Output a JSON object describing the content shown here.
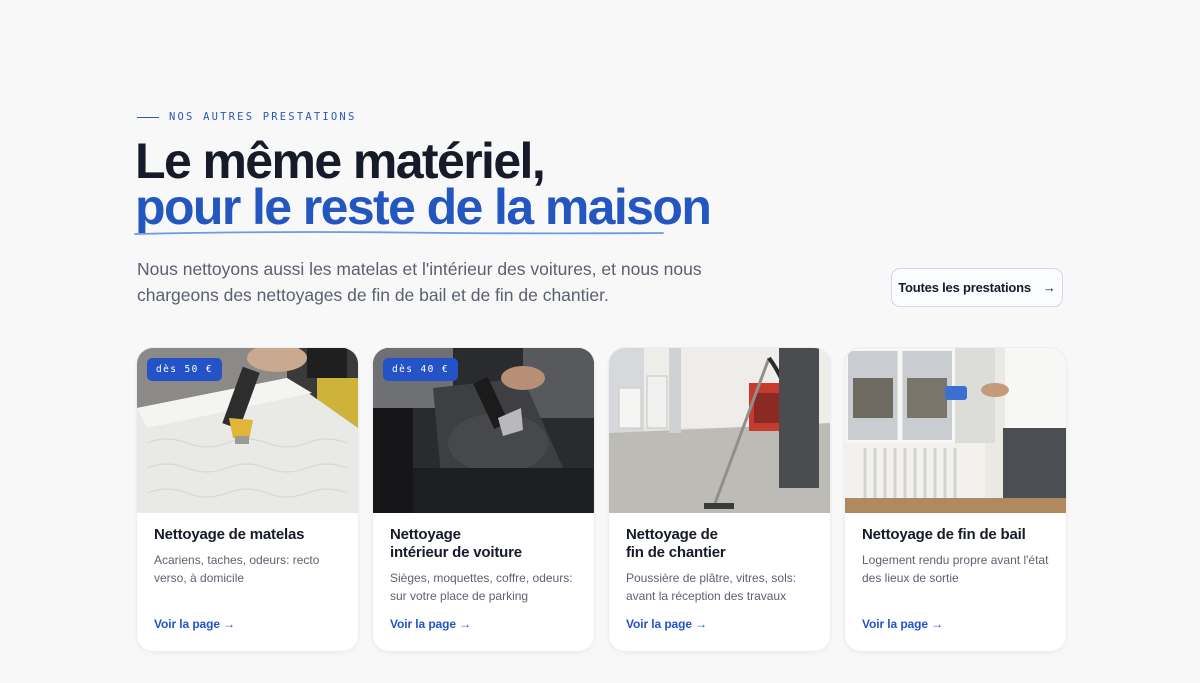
{
  "eyebrow": "NOS AUTRES PRESTATIONS",
  "headline": {
    "line1": "Le même matériel,",
    "line2": "pour le reste de la maison"
  },
  "lead": "Nous nettoyons aussi les matelas et l'intérieur des voitures, et nous nous chargeons des nettoyages de fin de bail et de fin de chantier.",
  "all_button": {
    "label": "Toutes les prestations",
    "arrow": "→"
  },
  "cards": [
    {
      "price": "dès 50 €",
      "title": "Nettoyage de matelas",
      "desc": "Acariens, taches, odeurs: recto verso, à domicile",
      "link": "Voir la page →",
      "photo": "mattress-cleaning-photo"
    },
    {
      "price": "dès 40 €",
      "title": "Nettoyage\nintérieur de voiture",
      "desc": "Sièges, moquettes, coffre, odeurs: sur votre place de parking",
      "link": "Voir la page →",
      "photo": "car-interior-photo"
    },
    {
      "price": "",
      "title": "Nettoyage de\nfin de chantier",
      "desc": "Poussière de plâtre, vitres, sols: avant la réception des travaux",
      "link": "Voir la page →",
      "photo": "construction-site-photo"
    },
    {
      "price": "",
      "title": "Nettoyage de fin de bail",
      "desc": "Logement rendu propre avant l'état des lieux de sortie",
      "link": "Voir la page →",
      "photo": "window-cleaning-photo"
    }
  ],
  "colors": {
    "accent": "#2453c8",
    "heading": "#171b29",
    "text": "#5b6070",
    "background": "#f8f8f8"
  }
}
